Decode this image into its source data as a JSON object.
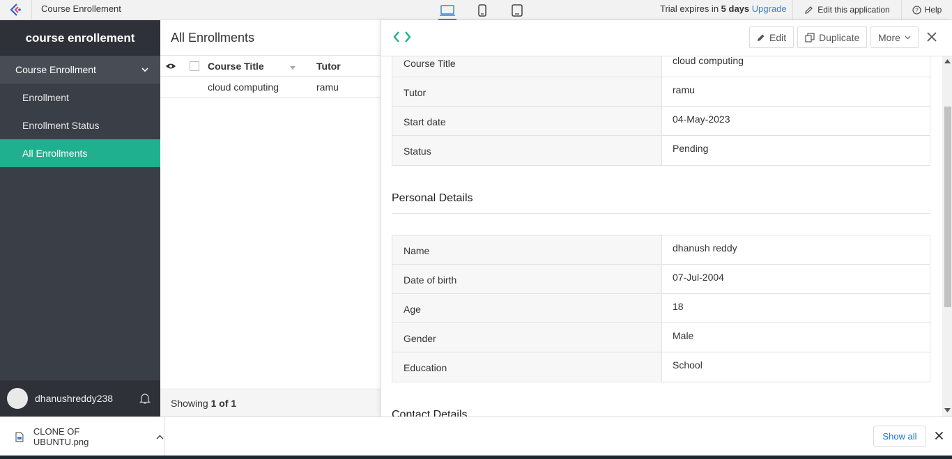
{
  "topbar": {
    "app_title": "Course Enrollement",
    "trial_prefix": "Trial expires in ",
    "trial_days": "5 days",
    "upgrade_label": "Upgrade",
    "edit_app_label": "Edit this application",
    "help_label": "Help"
  },
  "sidebar": {
    "app_name": "course enrollement",
    "section_label": "Course Enrollment",
    "items": [
      {
        "label": "Enrollment"
      },
      {
        "label": "Enrollment Status"
      },
      {
        "label": "All Enrollments"
      }
    ],
    "username": "dhanushreddy238"
  },
  "list": {
    "title": "All Enrollments",
    "columns": [
      "Course Title",
      "Tutor"
    ],
    "rows": [
      {
        "course_title": "cloud computing",
        "tutor": "ramu"
      }
    ],
    "footer_prefix": "Showing ",
    "footer_count": "1 of 1"
  },
  "detail": {
    "buttons": {
      "edit": "Edit",
      "duplicate": "Duplicate",
      "more": "More"
    },
    "enrollment_rows": [
      {
        "label": "Course Title",
        "value": "cloud computing"
      },
      {
        "label": "Tutor",
        "value": "ramu"
      },
      {
        "label": "Start date",
        "value": "04-May-2023"
      },
      {
        "label": "Status",
        "value": "Pending"
      }
    ],
    "personal_title": "Personal Details",
    "personal_rows": [
      {
        "label": "Name",
        "value": "dhanush reddy"
      },
      {
        "label": "Date of birth",
        "value": "07-Jul-2004"
      },
      {
        "label": "Age",
        "value": "18"
      },
      {
        "label": "Gender",
        "value": "Male"
      },
      {
        "label": "Education",
        "value": "School"
      }
    ],
    "contact_title": "Contact Details"
  },
  "downloads": {
    "file_name": "CLONE OF UBUNTU.png",
    "show_all": "Show all"
  },
  "colors": {
    "accent": "#1fb18f",
    "sidebar": "#3a3e46",
    "link": "#3a83d8"
  }
}
